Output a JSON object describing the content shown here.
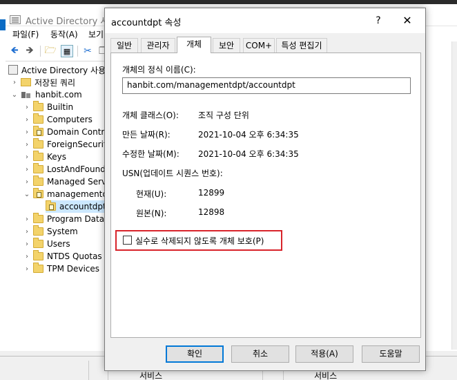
{
  "background_window": {
    "title": "Active Directory 사용",
    "menu": [
      "파일(F)",
      "동작(A)",
      "보기"
    ],
    "tree": {
      "root": "Active Directory 사용",
      "saved_queries": "저장된 쿼리",
      "domain": "hanbit.com",
      "children": [
        {
          "label": "Builtin",
          "ou": false
        },
        {
          "label": "Computers",
          "ou": false
        },
        {
          "label": "Domain Contro",
          "ou": true
        },
        {
          "label": "ForeignSecurity",
          "ou": false
        },
        {
          "label": "Keys",
          "ou": false
        },
        {
          "label": "LostAndFound",
          "ou": false
        },
        {
          "label": "Managed Servi",
          "ou": false
        },
        {
          "label": "managementdp",
          "ou": true
        }
      ],
      "selected_child": "accountdpt",
      "children_after": [
        {
          "label": "Program Data",
          "ou": false
        },
        {
          "label": "System",
          "ou": false
        },
        {
          "label": "Users",
          "ou": false
        },
        {
          "label": "NTDS Quotas",
          "ou": false
        },
        {
          "label": "TPM Devices",
          "ou": false
        }
      ]
    },
    "bottom_columns": [
      "서비스",
      "서비스"
    ]
  },
  "dialog": {
    "title": "accountdpt 속성",
    "help_glyph": "?",
    "close_glyph": "✕",
    "tabs": [
      "일반",
      "관리자",
      "개체",
      "보안",
      "COM+",
      "특성 편집기"
    ],
    "active_tab": "개체",
    "canonical_name_label": "개체의 정식 이름(C):",
    "canonical_name_value": "hanbit.com/managementdpt/accountdpt",
    "object_class_label": "개체 클래스(O):",
    "object_class_value": "조직 구성 단위",
    "created_label": "만든 날짜(R):",
    "created_value": "2021-10-04 오후 6:34:35",
    "modified_label": "수정한 날짜(M):",
    "modified_value": "2021-10-04 오후 6:34:35",
    "usn_label": "USN(업데이트 시퀀스 번호):",
    "usn_current_label": "현재(U):",
    "usn_current_value": "12899",
    "usn_original_label": "원본(N):",
    "usn_original_value": "12898",
    "protect_label": "실수로 삭제되지 않도록 개체 보호(P)",
    "protect_checked": false,
    "buttons": {
      "ok": "확인",
      "cancel": "취소",
      "apply": "적용(A)",
      "help": "도움말"
    }
  },
  "colors": {
    "highlight_border": "#d8232a",
    "default_button_border": "#0078d7",
    "dialog_bg": "#f0f0f0"
  }
}
